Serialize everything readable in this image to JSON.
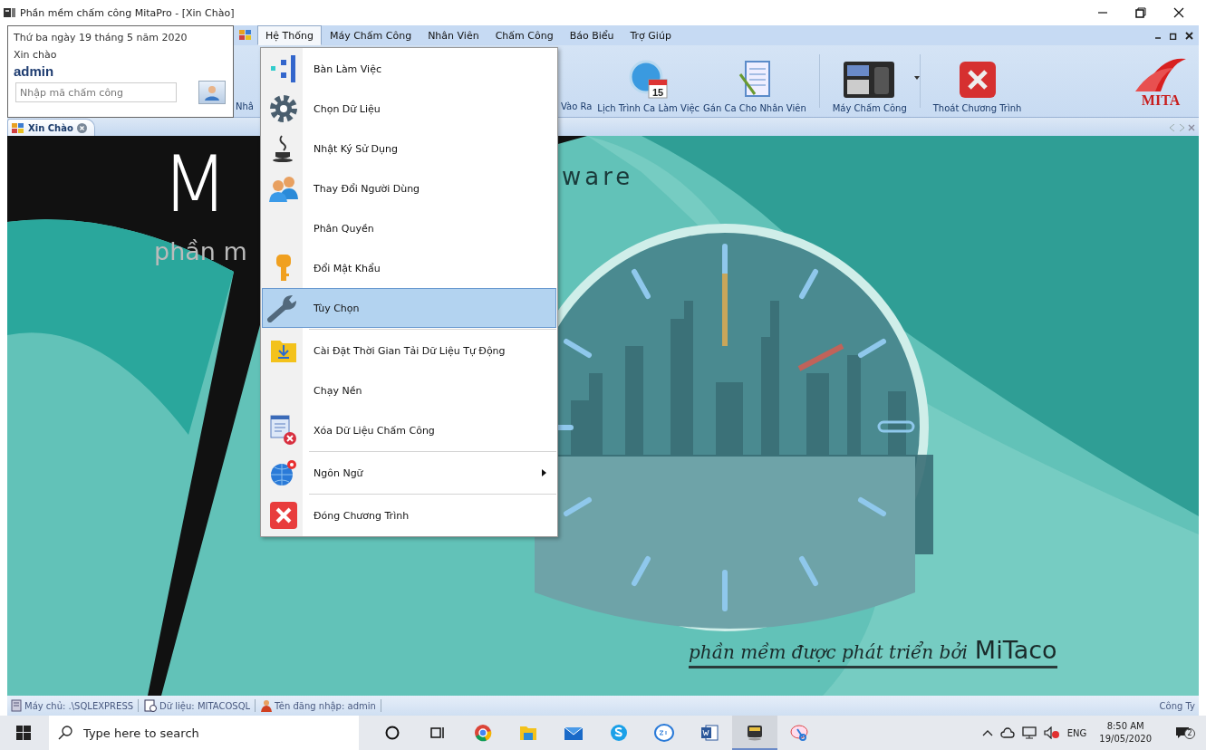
{
  "window": {
    "title": "Phần mềm chấm công MitaPro - [Xin Chào]"
  },
  "info_panel": {
    "date": "Thứ ba ngày 19 tháng 5 năm 2020",
    "greeting": "Xin chào",
    "user": "admin",
    "code_field": {
      "placeholder": "Nhập mã chấm công"
    }
  },
  "menu_bar": [
    {
      "label": "Hệ Thống",
      "selected": true
    },
    {
      "label": "Máy Chấm Công",
      "selected": false
    },
    {
      "label": "Nhân Viên",
      "selected": false
    },
    {
      "label": "Chấm Công",
      "selected": false
    },
    {
      "label": "Báo Biểu",
      "selected": false
    },
    {
      "label": "Trợ Giúp",
      "selected": false
    }
  ],
  "toolbar": [
    {
      "label": "Nhâ",
      "kind": "partial-left",
      "dropdown": false
    },
    {
      "label": "Vào Ra",
      "kind": "partial-right",
      "dropdown": false
    },
    {
      "label": "Lịch Trình Ca Làm Việc",
      "kind": "calendar",
      "dropdown": false,
      "icon_text": "15"
    },
    {
      "label": "Gán Ca Cho Nhân Viên",
      "kind": "checklist",
      "dropdown": false
    },
    {
      "label": "Máy Chấm Công",
      "kind": "device",
      "dropdown": true
    },
    {
      "label": "Thoát Chương Trình",
      "kind": "exit",
      "dropdown": false
    }
  ],
  "logo_text": "MITA",
  "tabs": [
    {
      "label": "Xin Chào",
      "selected": true
    }
  ],
  "splash": {
    "big_letter": "M",
    "word_fragment": "ware",
    "subtitle_fragment": "phần m",
    "tagline": "phần mềm được phát triển bởi",
    "brand": "MiTaco"
  },
  "dropdown_menu": [
    {
      "label": "Bàn Làm Việc",
      "selected": false,
      "separator_before": false,
      "submenu": false
    },
    {
      "label": "Chọn Dữ Liệu",
      "selected": false,
      "separator_before": false,
      "submenu": false
    },
    {
      "label": "Nhật Ký Sử Dụng",
      "selected": false,
      "separator_before": false,
      "submenu": false
    },
    {
      "label": "Thay Đổi Người Dùng",
      "selected": false,
      "separator_before": false,
      "submenu": false
    },
    {
      "label": "Phân Quyền",
      "selected": false,
      "separator_before": false,
      "submenu": false
    },
    {
      "label": "Đổi Mật Khẩu",
      "selected": false,
      "separator_before": false,
      "submenu": false
    },
    {
      "label": "Tùy Chọn",
      "selected": true,
      "separator_before": false,
      "submenu": false
    },
    {
      "label": "Cài Đặt Thời Gian Tải Dữ Liệu Tự Động",
      "selected": false,
      "separator_before": true,
      "submenu": false
    },
    {
      "label": "Chạy Nền",
      "selected": false,
      "separator_before": false,
      "submenu": false
    },
    {
      "label": "Xóa Dữ Liệu Chấm Công",
      "selected": false,
      "separator_before": false,
      "submenu": false
    },
    {
      "label": "Ngôn Ngữ",
      "selected": false,
      "separator_before": true,
      "submenu": true
    },
    {
      "label": "Đóng Chương Trình",
      "selected": false,
      "separator_before": true,
      "submenu": false
    }
  ],
  "status_bar": [
    {
      "label": "Máy chủ: .\\SQLEXPRESS"
    },
    {
      "label": "Dữ liệu: MITACOSQL"
    },
    {
      "label": "Tên đăng nhập: admin"
    }
  ],
  "status_right": "Công Ty",
  "taskbar": {
    "search": {
      "placeholder": "Type here to search"
    },
    "apps": [
      {
        "kind": "cortana",
        "active": false
      },
      {
        "kind": "taskview",
        "active": false
      },
      {
        "kind": "chrome",
        "active": false
      },
      {
        "kind": "explorer",
        "active": false
      },
      {
        "kind": "mail",
        "active": false
      },
      {
        "kind": "skype",
        "active": false
      },
      {
        "kind": "zalo",
        "active": false
      },
      {
        "kind": "word",
        "active": false
      },
      {
        "kind": "device",
        "active": true
      },
      {
        "kind": "snip",
        "active": false
      }
    ],
    "language": "ENG",
    "time": "8:50 AM",
    "date": "19/05/2020",
    "notifications": "2"
  }
}
